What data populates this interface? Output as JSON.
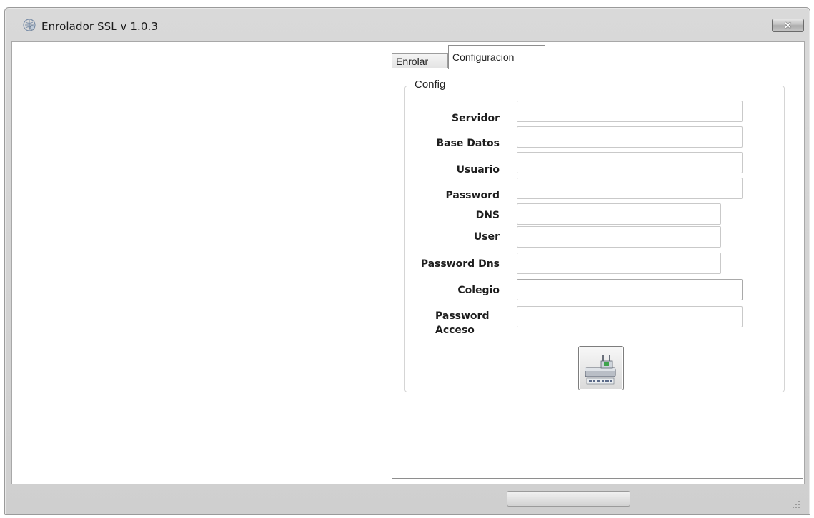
{
  "window": {
    "title": "Enrolador SSL v 1.0.3",
    "close_symbol": "✕",
    "app_icon": "network-app-icon"
  },
  "tabs": [
    {
      "label": "Enrolar",
      "active": false
    },
    {
      "label": "Configuracion",
      "active": true
    }
  ],
  "config": {
    "group_title": "Config",
    "fields": {
      "servidor": {
        "label": "Servidor",
        "value": ""
      },
      "base_datos": {
        "label": "Base Datos",
        "value": ""
      },
      "usuario": {
        "label": "Usuario",
        "value": ""
      },
      "password": {
        "label": "Password",
        "value": ""
      },
      "dns": {
        "label": "DNS",
        "value": ""
      },
      "user": {
        "label": "User",
        "value": ""
      },
      "password_dns": {
        "label": "Password Dns",
        "value": ""
      },
      "colegio": {
        "label": "Colegio",
        "value": ""
      },
      "password_acceso": {
        "label": "Password Acceso",
        "value": ""
      }
    },
    "save_button": {
      "icon": "save-config-icon"
    }
  },
  "statusbar": {
    "progress": 0
  }
}
